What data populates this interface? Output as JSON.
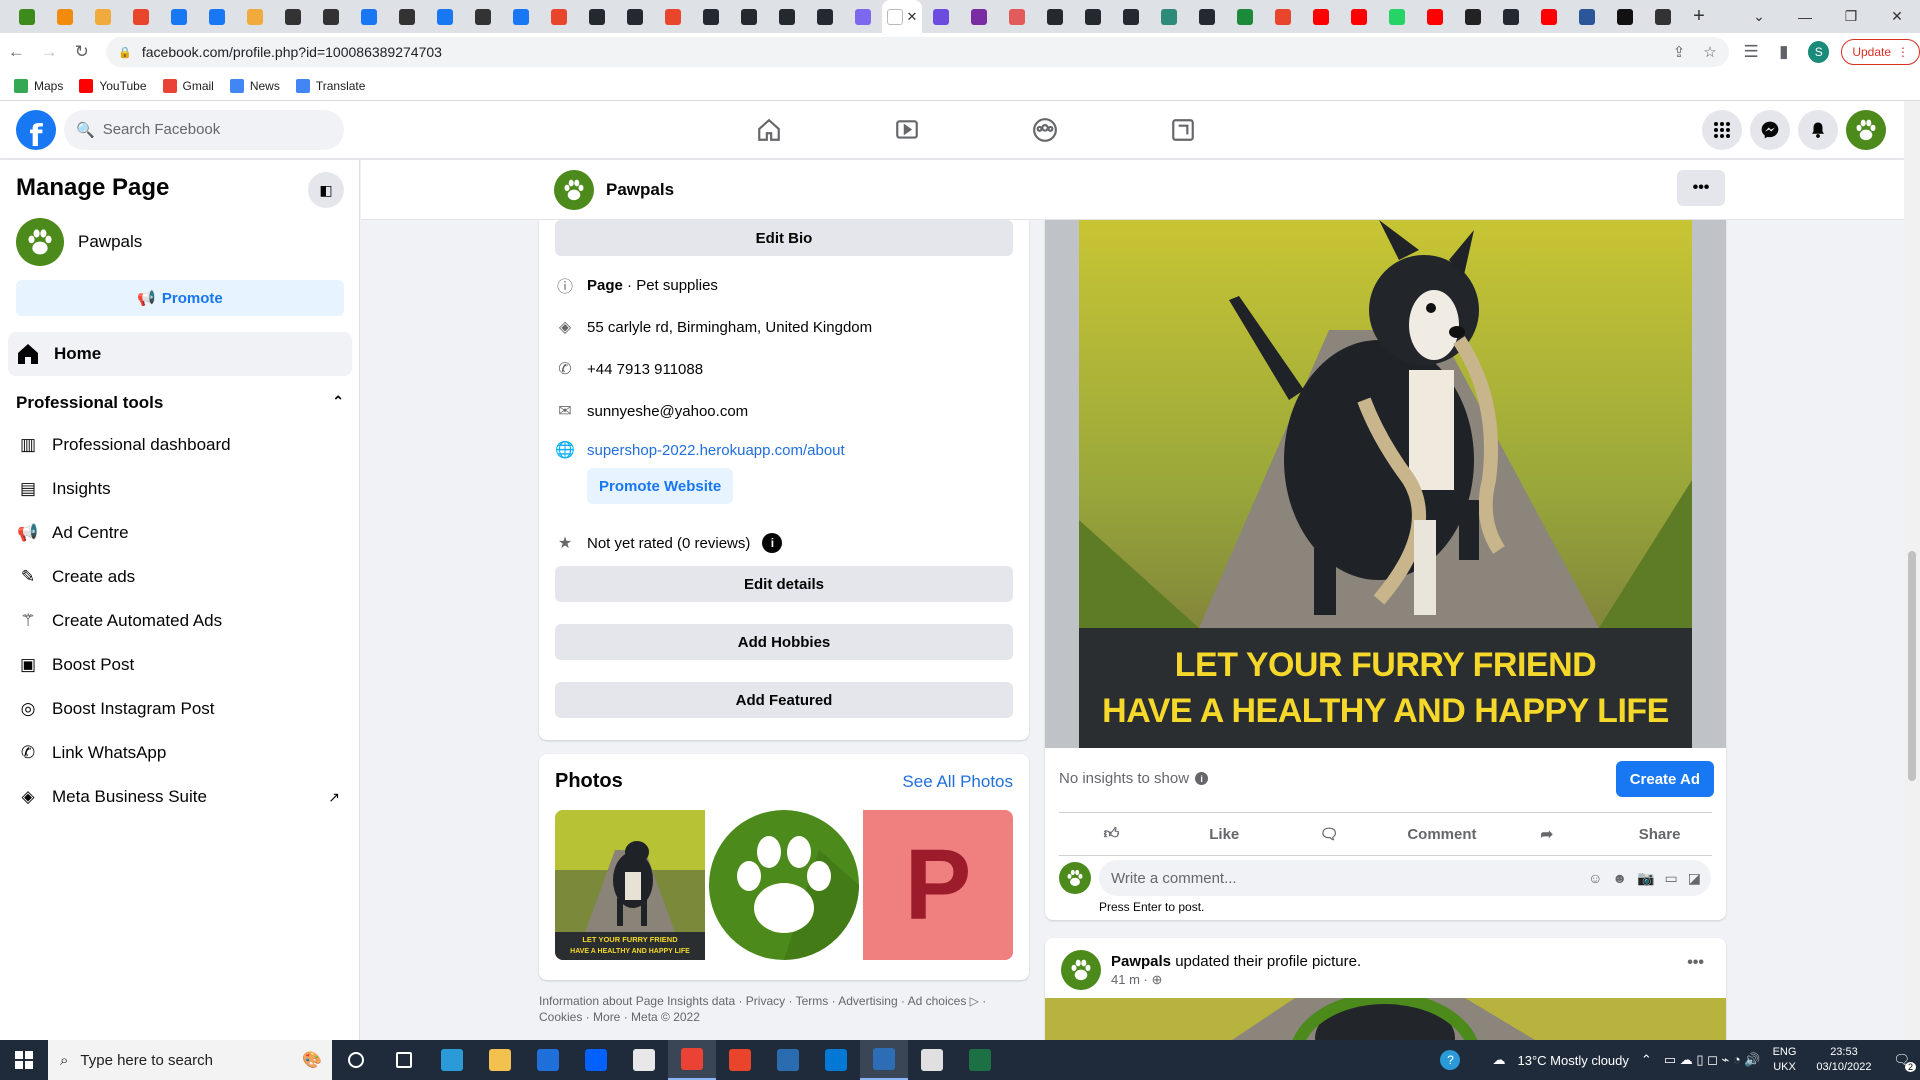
{
  "browser": {
    "tab_favicon_colors": [
      "#3d8b1a",
      "#f28b0c",
      "#f0ab3c",
      "#e8452c",
      "#1877f2",
      "#1877f2",
      "#f0ab3c",
      "#333333",
      "#333333",
      "#1877f2",
      "#333333",
      "#1877f2",
      "#333333",
      "#1877f2",
      "#e8452c",
      "#24292f",
      "#24292f",
      "#e8452c",
      "#24292f",
      "#24292f",
      "#24292f",
      "#24292f",
      "#7b68ee",
      "#ffffff",
      "#6c4cdf",
      "#7a2ca3",
      "#e25a5a",
      "#24292f",
      "#24292f",
      "#24292f",
      "#2e8b7a",
      "#24292f",
      "#1b8a3a",
      "#e8452c",
      "#ff0000",
      "#ff0000",
      "#25d366",
      "#ff0000",
      "#222222",
      "#24292f",
      "#ff0000",
      "#2b579a",
      "#111111",
      "#333333"
    ],
    "active_tab_close": "✕",
    "new_tab": "+",
    "window_controls": [
      "⌄",
      "—",
      "❐",
      "✕"
    ],
    "url": "facebook.com/profile.php?id=100086389274703",
    "profile_initial": "S",
    "update_label": "Update",
    "bookmarks": [
      {
        "label": "Maps",
        "color": "#34a853"
      },
      {
        "label": "YouTube",
        "color": "#ff0000"
      },
      {
        "label": "Gmail",
        "color": "#ea4335"
      },
      {
        "label": "News",
        "color": "#4285f4"
      },
      {
        "label": "Translate",
        "color": "#4285f4"
      }
    ]
  },
  "fb": {
    "logo": "f",
    "search_placeholder": "Search Facebook"
  },
  "sidebar": {
    "title": "Manage Page",
    "page_name": "Pawpals",
    "promote": "Promote",
    "home": "Home",
    "professional_tools": "Professional tools",
    "items": [
      {
        "label": "Professional dashboard",
        "icon": "dashboard-icon",
        "glyph": "▥"
      },
      {
        "label": "Insights",
        "icon": "insights-icon",
        "glyph": "▤"
      },
      {
        "label": "Ad Centre",
        "icon": "megaphone-icon",
        "glyph": "📢"
      },
      {
        "label": "Create ads",
        "icon": "pencil-icon",
        "glyph": "✎"
      },
      {
        "label": "Create Automated Ads",
        "icon": "magic-wand-icon",
        "glyph": "⚚"
      },
      {
        "label": "Boost Post",
        "icon": "boost-post-icon",
        "glyph": "▣"
      },
      {
        "label": "Boost Instagram Post",
        "icon": "instagram-icon",
        "glyph": "◎"
      },
      {
        "label": "Link WhatsApp",
        "icon": "whatsapp-icon",
        "glyph": "✆"
      },
      {
        "label": "Meta Business Suite",
        "icon": "meta-business-icon",
        "glyph": "◈"
      }
    ]
  },
  "subheader": {
    "page_name": "Pawpals",
    "more": "•••"
  },
  "intro": {
    "edit_bio": "Edit Bio",
    "category_bold": "Page",
    "category_rest": " · Pet supplies",
    "address": "55 carlyle rd, Birmingham, United Kingdom",
    "phone": "+44 7913 911088",
    "email": "sunnyeshe@yahoo.com",
    "website": "supershop-2022.herokuapp.com/about",
    "promote_website": "Promote Website",
    "rating": "Not yet rated (0 reviews)",
    "edit_details": "Edit details",
    "add_hobbies": "Add Hobbies",
    "add_featured": "Add Featured"
  },
  "photos": {
    "title": "Photos",
    "see_all": "See All Photos",
    "thumb_caption_1": "LET YOUR FURRY FRIEND",
    "thumb_caption_2": "HAVE A HEALTHY AND HAPPY LIFE",
    "thumb3_letter": "P"
  },
  "footer": {
    "text": "Information about Page Insights data · Privacy · Terms · Advertising · Ad choices ▷ · Cookies · More · Meta © 2022"
  },
  "post": {
    "caption_line1": "LET YOUR FURRY FRIEND",
    "caption_line2": "HAVE A HEALTHY AND HAPPY LIFE",
    "no_insights": "No insights to show",
    "create_ad": "Create Ad",
    "like": "Like",
    "comment": "Comment",
    "share": "Share",
    "comment_placeholder": "Write a comment...",
    "press_enter": "Press Enter to post."
  },
  "post2": {
    "name": "Pawpals",
    "action": " updated their profile picture.",
    "time": "41 m · ",
    "more": "•••"
  },
  "taskbar": {
    "search_placeholder": "Type here to search",
    "weather": "13°C  Mostly cloudy",
    "lang1": "ENG",
    "lang2": "UKX",
    "time": "23:53",
    "date": "03/10/2022",
    "notif_count": "2",
    "app_colors": [
      "#ffffff",
      "#ffffff",
      "#2a9bd8",
      "#f2c14e",
      "#1e6fd9",
      "#0061fe",
      "#e8e8e8",
      "#ea4335",
      "#e8452c",
      "#2b6cb0",
      "#0078d4",
      "#2d6db5",
      "#e0e0e0",
      "#1d7044"
    ]
  }
}
